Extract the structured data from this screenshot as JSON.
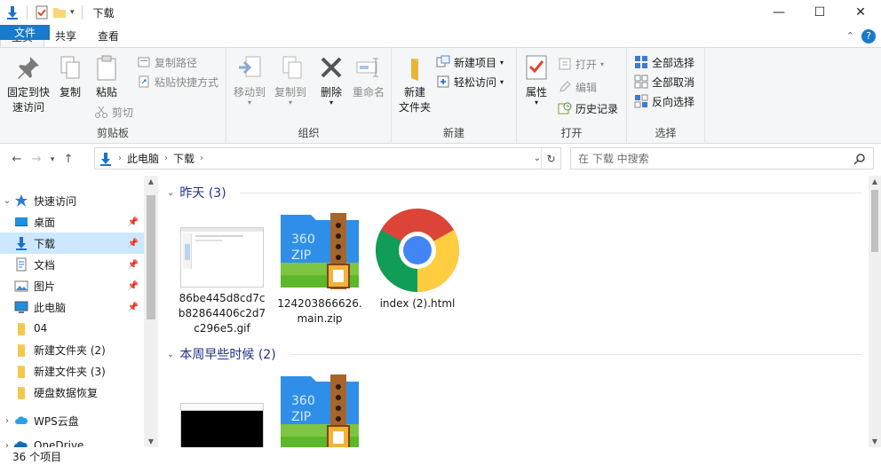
{
  "window": {
    "title": "下载",
    "controls": {
      "minimize": "—",
      "maximize": "☐",
      "close": "✕"
    }
  },
  "tabs": [
    "文件",
    "主页",
    "共享",
    "查看"
  ],
  "ribbon": {
    "clipboard": {
      "pin": "固定到快\n速访问",
      "copy": "复制",
      "paste": "粘贴",
      "copy_path": "复制路径",
      "paste_shortcut": "粘贴快捷方式",
      "cut": "剪切",
      "label": "剪贴板"
    },
    "organize": {
      "move_to": "移动到",
      "copy_to": "复制到",
      "delete": "删除",
      "rename": "重命名",
      "label": "组织"
    },
    "new": {
      "new_folder": "新建\n文件夹",
      "new_item": "新建项目",
      "easy_access": "轻松访问",
      "label": "新建"
    },
    "open": {
      "properties": "属性",
      "open": "打开",
      "edit": "编辑",
      "history": "历史记录",
      "label": "打开"
    },
    "select": {
      "select_all": "全部选择",
      "select_none": "全部取消",
      "invert": "反向选择",
      "label": "选择"
    }
  },
  "address": {
    "crumbs": [
      "此电脑",
      "下载"
    ],
    "search_placeholder": "在 下载 中搜索"
  },
  "nav": {
    "quick_access": "快速访问",
    "items": [
      {
        "label": "桌面",
        "icon": "desktop-icon",
        "pinned": true
      },
      {
        "label": "下载",
        "icon": "download-icon",
        "pinned": true,
        "selected": true
      },
      {
        "label": "文档",
        "icon": "document-icon",
        "pinned": true
      },
      {
        "label": "图片",
        "icon": "pictures-icon",
        "pinned": true
      },
      {
        "label": "此电脑",
        "icon": "computer-icon",
        "pinned": true
      },
      {
        "label": "04",
        "icon": "folder-icon",
        "pinned": false
      },
      {
        "label": "新建文件夹 (2)",
        "icon": "folder-icon",
        "pinned": false
      },
      {
        "label": "新建文件夹 (3)",
        "icon": "folder-icon",
        "pinned": false
      },
      {
        "label": "硬盘数据恢复",
        "icon": "folder-icon",
        "pinned": false
      }
    ],
    "wps": "WPS云盘",
    "onedrive": "OneDrive"
  },
  "groups": [
    {
      "heading": "昨天 (3)",
      "files": [
        {
          "name": "86be445d8cd7cb82864406c2d7c296e5.gif",
          "type": "gif-thumbnail"
        },
        {
          "name": "124203866626.main.zip",
          "type": "zip-360-icon"
        },
        {
          "name": "index (2).html",
          "type": "chrome-icon"
        }
      ]
    },
    {
      "heading": "本周早些时候 (2)",
      "files": [
        {
          "name": "",
          "type": "black-thumbnail"
        },
        {
          "name": "",
          "type": "zip-360-icon"
        }
      ]
    }
  ],
  "status": {
    "count": "36 个项目"
  }
}
